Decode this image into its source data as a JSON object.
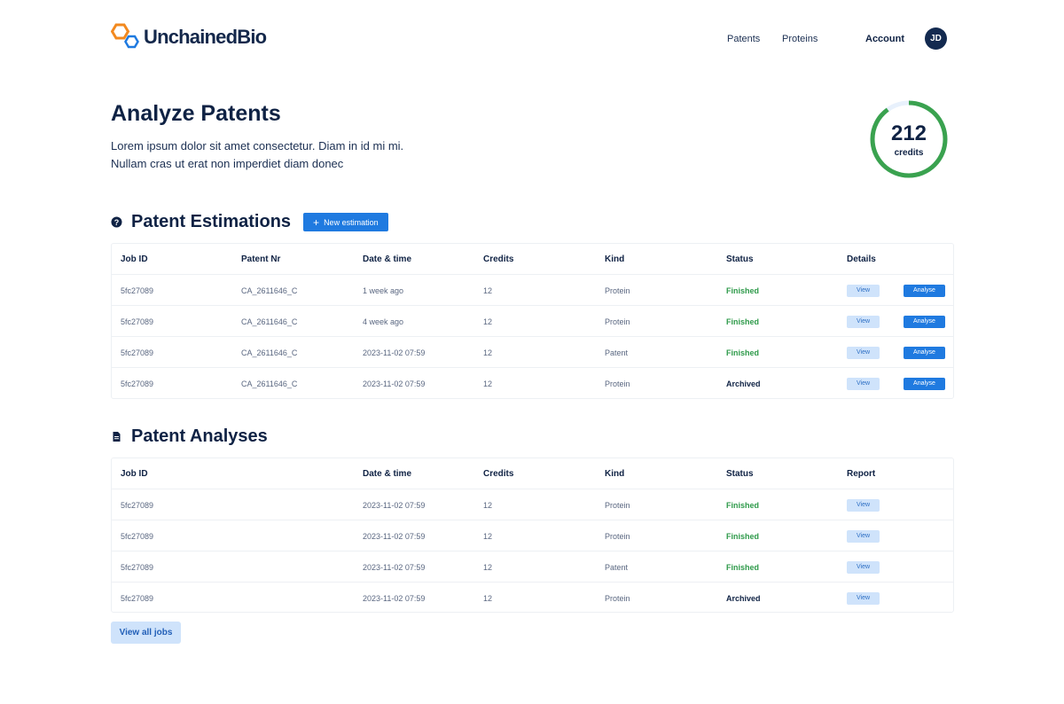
{
  "brand": {
    "name": "UnchainedBio",
    "colors": {
      "orange": "#f2891f",
      "blue": "#1f7ae0",
      "navy": "#0f2244",
      "green": "#2e9a4a"
    }
  },
  "nav": {
    "patents": "Patents",
    "proteins": "Proteins",
    "account": "Account",
    "avatar_initials": "JD"
  },
  "hero": {
    "title": "Analyze Patents",
    "description_line1": "Lorem ipsum dolor sit amet consectetur. Diam in id mi mi.",
    "description_line2": "Nullam cras ut erat non imperdiet diam donec"
  },
  "credits": {
    "value": "212",
    "label": "credits",
    "ring_fraction": 0.9
  },
  "estimations": {
    "title": "Patent Estimations",
    "icon": "question-circle-icon",
    "new_button": "New estimation",
    "columns": [
      "Job ID",
      "Patent Nr",
      "Date & time",
      "Credits",
      "Kind",
      "Status",
      "Details"
    ],
    "rows": [
      {
        "job_id": "5fc27089",
        "patent_nr": "CA_2611646_C",
        "date": "1 week ago",
        "credits": "12",
        "kind": "Protein",
        "status": "Finished",
        "view": "View",
        "analyse": "Analyse"
      },
      {
        "job_id": "5fc27089",
        "patent_nr": "CA_2611646_C",
        "date": "4 week ago",
        "credits": "12",
        "kind": "Protein",
        "status": "Finished",
        "view": "View",
        "analyse": "Analyse"
      },
      {
        "job_id": "5fc27089",
        "patent_nr": "CA_2611646_C",
        "date": "2023-11-02 07:59",
        "credits": "12",
        "kind": "Patent",
        "status": "Finished",
        "view": "View",
        "analyse": "Analyse"
      },
      {
        "job_id": "5fc27089",
        "patent_nr": "CA_2611646_C",
        "date": "2023-11-02 07:59",
        "credits": "12",
        "kind": "Protein",
        "status": "Archived",
        "view": "View",
        "analyse": "Analyse"
      }
    ]
  },
  "analyses": {
    "title": "Patent Analyses",
    "icon": "document-icon",
    "columns": [
      "Job ID",
      "Date & time",
      "Credits",
      "Kind",
      "Status",
      "Report"
    ],
    "rows": [
      {
        "job_id": "5fc27089",
        "date": "2023-11-02 07:59",
        "credits": "12",
        "kind": "Protein",
        "status": "Finished",
        "view": "View"
      },
      {
        "job_id": "5fc27089",
        "date": "2023-11-02 07:59",
        "credits": "12",
        "kind": "Protein",
        "status": "Finished",
        "view": "View"
      },
      {
        "job_id": "5fc27089",
        "date": "2023-11-02 07:59",
        "credits": "12",
        "kind": "Patent",
        "status": "Finished",
        "view": "View"
      },
      {
        "job_id": "5fc27089",
        "date": "2023-11-02 07:59",
        "credits": "12",
        "kind": "Protein",
        "status": "Archived",
        "view": "View"
      }
    ],
    "view_all_button": "View all jobs"
  }
}
